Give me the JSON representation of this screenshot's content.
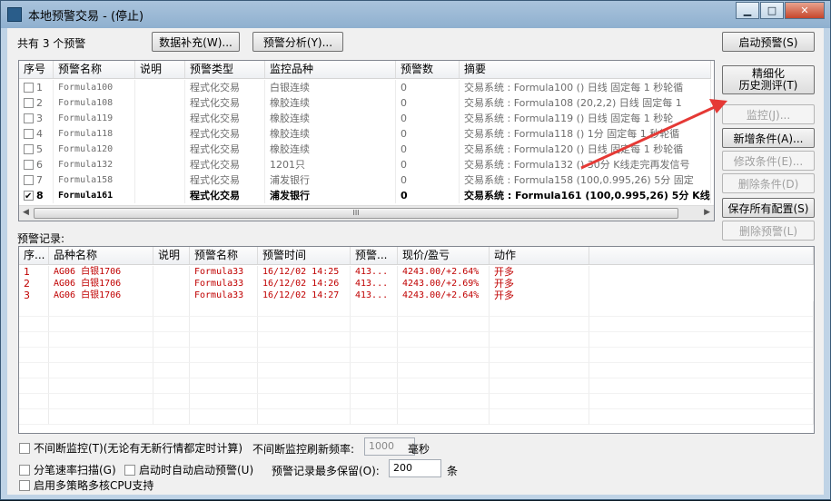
{
  "window": {
    "title": "本地预警交易 - (停止)"
  },
  "top": {
    "count_label": "共有 3 个预警",
    "supplement_button": "数据补充(W)...",
    "analysis_button": "预警分析(Y)..."
  },
  "right_buttons": {
    "start": "启动预警(S)",
    "refine_line1": "精细化",
    "refine_line2": "历史测评(T)",
    "monitor": "监控(J)...",
    "add_condition": "新增条件(A)...",
    "edit_condition": "修改条件(E)...",
    "delete_condition": "删除条件(D)",
    "save_all": "保存所有配置(S)",
    "delete_alert": "删除预警(L)"
  },
  "formula_table": {
    "headers": [
      "序号",
      "预警名称",
      "说明",
      "预警类型",
      "监控品种",
      "预警数",
      "摘要"
    ],
    "rows": [
      {
        "no": "1",
        "checked": false,
        "name": "Formula100",
        "desc": "",
        "type": "程式化交易",
        "target": "白银连续",
        "count": "0",
        "summary": "交易系统 : Formula100 () 日线 固定每 1 秒轮循"
      },
      {
        "no": "2",
        "checked": false,
        "name": "Formula108",
        "desc": "",
        "type": "程式化交易",
        "target": "橡胶连续",
        "count": "0",
        "summary": "交易系统 : Formula108 (20,2,2) 日线 固定每 1"
      },
      {
        "no": "3",
        "checked": false,
        "name": "Formula119",
        "desc": "",
        "type": "程式化交易",
        "target": "橡胶连续",
        "count": "0",
        "summary": "交易系统 : Formula119 () 日线 固定每 1 秒轮"
      },
      {
        "no": "4",
        "checked": false,
        "name": "Formula118",
        "desc": "",
        "type": "程式化交易",
        "target": "橡胶连续",
        "count": "0",
        "summary": "交易系统 : Formula118 () 1分 固定每 1 秒轮循"
      },
      {
        "no": "5",
        "checked": false,
        "name": "Formula120",
        "desc": "",
        "type": "程式化交易",
        "target": "橡胶连续",
        "count": "0",
        "summary": "交易系统 : Formula120 () 日线 固定每 1 秒轮循"
      },
      {
        "no": "6",
        "checked": false,
        "name": "Formula132",
        "desc": "",
        "type": "程式化交易",
        "target": "1201只",
        "count": "0",
        "summary": "交易系统 : Formula132 () 30分 K线走完再发信号"
      },
      {
        "no": "7",
        "checked": false,
        "name": "Formula158",
        "desc": "",
        "type": "程式化交易",
        "target": "浦发银行",
        "count": "0",
        "summary": "交易系统 : Formula158 (100,0.995,26) 5分 固定"
      },
      {
        "no": "8",
        "checked": true,
        "name": "Formula161",
        "desc": "",
        "type": "程式化交易",
        "target": "浦发银行",
        "count": "0",
        "summary": "交易系统 : Formula161 (100,0.995,26) 5分 K线"
      }
    ]
  },
  "records": {
    "label": "预警记录:",
    "headers": [
      "序...",
      "品种名称",
      "说明",
      "预警名称",
      "预警时间",
      "预警...",
      "现价/盈亏",
      "动作"
    ],
    "rows": [
      {
        "no": "1",
        "symbol": "AG06 白银1706",
        "desc": "",
        "name": "Formula33",
        "time": "16/12/02 14:25",
        "price": "413...",
        "pnl": "4243.00/+2.64%",
        "action": "开多"
      },
      {
        "no": "2",
        "symbol": "AG06 白银1706",
        "desc": "",
        "name": "Formula33",
        "time": "16/12/02 14:26",
        "price": "413...",
        "pnl": "4243.00/+2.69%",
        "action": "开多"
      },
      {
        "no": "3",
        "symbol": "AG06 白银1706",
        "desc": "",
        "name": "Formula33",
        "time": "16/12/02 14:27",
        "price": "413...",
        "pnl": "4243.00/+2.64%",
        "action": "开多"
      }
    ]
  },
  "bottom": {
    "continuous_monitor": "不间断监控(T)(无论有无新行情都定时计算)",
    "refresh_label": "不间断监控刷新频率:",
    "refresh_value": "1000",
    "refresh_unit": "毫秒",
    "tick_scan": "分笔速率扫描(G)",
    "auto_start": "启动时自动启动预警(U)",
    "max_keep_label": "预警记录最多保留(O):",
    "max_keep_value": "200",
    "max_keep_unit": "条",
    "multi_core": "启用多策略多核CPU支持"
  },
  "colors": {
    "alert_text": "#c00000",
    "annotation_arrow": "#e53935"
  }
}
